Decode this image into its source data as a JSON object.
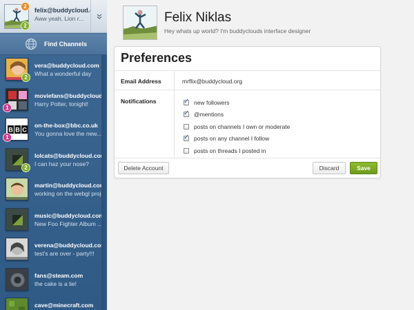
{
  "me": {
    "name": "felix@buddycloud.com",
    "status": "Aww yeah, Lion r...",
    "badges": [
      "2",
      "2"
    ],
    "collapse_icon": "chevron-down-icon"
  },
  "find_channels": {
    "label": "Find Channels",
    "icon": "globe-icon"
  },
  "channels": [
    {
      "name": "vera@buddycloud.com",
      "message": "What a wonderful day",
      "badge": "2",
      "badge_color": "#80ad2b"
    },
    {
      "name": "moviefans@buddycloud.com",
      "message": "Harry Potter, tonight!",
      "badge": "1",
      "badge_color": "#c93c88"
    },
    {
      "name": "on-the-box@bbc.co.uk",
      "message": "You gonna love the new...",
      "badge": "1",
      "badge_color": "#c93c88",
      "logo": "BBC"
    },
    {
      "name": "lolcats@buddycloud.com",
      "message": "I can haz your nose?",
      "badge": "2",
      "badge_color": "#80ad2b"
    },
    {
      "name": "martin@buddycloud.com",
      "message": "working on the webgl proje..."
    },
    {
      "name": "music@buddycloud.com",
      "message": "New Foo Fighter Album ..."
    },
    {
      "name": "verena@buddycloud.com",
      "message": "test's are over - party!!!"
    },
    {
      "name": "fans@steam.com",
      "message": "the cake is a lie!"
    },
    {
      "name": "cave@minecraft.com",
      "message": ""
    }
  ],
  "profile": {
    "name": "Felix Niklas",
    "bio": "Hey whats up world? I'm buddyclouds interface designer"
  },
  "preferences": {
    "title": "Preferences",
    "email_label": "Email Address",
    "email_value": "mrflix@buddycloud.org",
    "notifications_label": "Notifications",
    "options": [
      {
        "label": "new followers",
        "checked": true
      },
      {
        "label": "@mentions",
        "checked": true
      },
      {
        "label": "posts on channels I own or moderate",
        "checked": false
      },
      {
        "label": "posts on any channel I follow",
        "checked": true
      },
      {
        "label": "posts on threads I posted in",
        "checked": false
      }
    ],
    "delete_label": "Delete Account",
    "discard_label": "Discard",
    "save_label": "Save"
  },
  "colors": {
    "sidebar": "#3f6a96",
    "accent_save": "#7aa624"
  }
}
